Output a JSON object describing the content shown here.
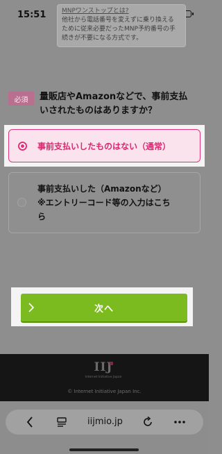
{
  "status_bar": {
    "time": "15:51"
  },
  "tooltip": {
    "title": "MNPワンストップとは?",
    "lines": [
      "他社から電話番号を変えずに乗り換える",
      "ために従来必要だったMNP予約番号の手",
      "続きが不要になる方式です。"
    ]
  },
  "question": {
    "badge": "必須",
    "lines": [
      "量販店やAmazonなどで、事前支払",
      "いされたものはありますか？"
    ]
  },
  "options": [
    {
      "label": "事前支払いしたものはない（通常）",
      "selected": true
    },
    {
      "lines": [
        "事前支払いした（Amazonなど）",
        "※エントリーコード等の入力はこち",
        "ら"
      ],
      "selected": false
    }
  ],
  "next_button": {
    "label": "次へ"
  },
  "footer": {
    "logo": "IIJ",
    "logo_sub": "Internet Initiative Japan",
    "copyright": "© Internet Initiative Japan Inc."
  },
  "browser": {
    "url": "iijmio.jp"
  },
  "colors": {
    "accent_pink": "#e2307a",
    "button_green": "#7cbb1f",
    "footer_bg": "#151515"
  }
}
